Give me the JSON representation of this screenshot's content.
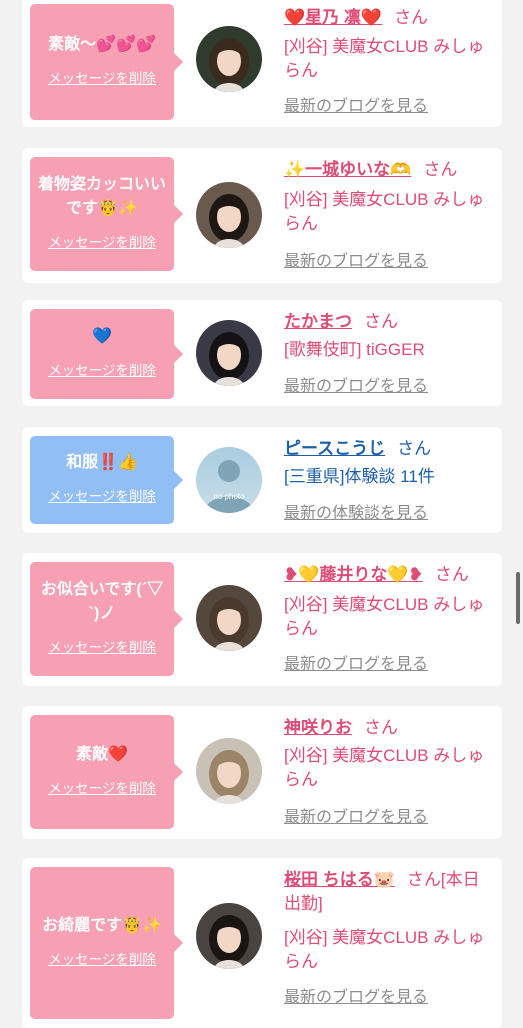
{
  "favorites": [
    {
      "message": "素敵〜💕💕💕",
      "delete_label": "メッセージを削除",
      "name": "❤️星乃 凛❤️",
      "honorific": "さん",
      "shop": "[刈谷] 美魔女CLUB みしゅらん",
      "link": "最新のブログを見る",
      "theme": "pink",
      "avatar": "woman-portrait"
    },
    {
      "message": "着物姿カッコいいです🤴✨",
      "delete_label": "メッセージを削除",
      "name": "✨一城ゆいな🫶",
      "honorific": "さん",
      "shop": "[刈谷] 美魔女CLUB みしゅらん",
      "link": "最新のブログを見る",
      "theme": "pink",
      "avatar": "woman-portrait"
    },
    {
      "message": "💙",
      "delete_label": "メッセージを削除",
      "name": "たかまつ",
      "honorific": "さん",
      "shop": "[歌舞伎町] tiGGER",
      "link": "最新のブログを見る",
      "theme": "pink",
      "avatar": "woman-portrait"
    },
    {
      "message": "和服‼️👍",
      "delete_label": "メッセージを削除",
      "name": "ピースこうじ",
      "honorific": "さん",
      "shop": "[三重県]体験談 11件",
      "link": "最新の体験談を見る",
      "theme": "blue",
      "avatar": "no-photo",
      "avatar_text": "no photo"
    },
    {
      "message": "お似合いです(´▽`)ノ",
      "delete_label": "メッセージを削除",
      "name": "❥💛藤井りな💛❥",
      "honorific": "さん",
      "shop": "[刈谷] 美魔女CLUB みしゅらん",
      "link": "最新のブログを見る",
      "theme": "pink",
      "avatar": "woman-portrait"
    },
    {
      "message": "素敵❤️",
      "delete_label": "メッセージを削除",
      "name": "神咲りお",
      "honorific": "さん",
      "shop": "[刈谷] 美魔女CLUB みしゅらん",
      "link": "最新のブログを見る",
      "theme": "pink",
      "avatar": "woman-portrait"
    },
    {
      "message": "お綺麗です🤴✨",
      "delete_label": "メッセージを削除",
      "name": "桜田 ちはる🐷",
      "honorific": "さん",
      "extra": "[本日出勤]",
      "shop": "[刈谷] 美魔女CLUB みしゅらん",
      "link": "最新のブログを見る",
      "theme": "pink",
      "avatar": "woman-portrait"
    }
  ],
  "colors": {
    "pink_bubble": "#f7a0b4",
    "blue_bubble": "#90bef5",
    "pink_text": "#de4c75",
    "blue_text": "#1c5fa8"
  }
}
